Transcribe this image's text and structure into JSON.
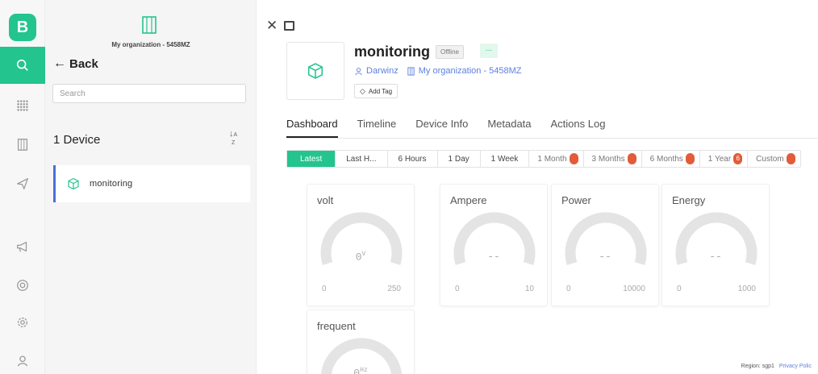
{
  "app": {
    "logo_letter": "B"
  },
  "panel": {
    "org_name": "My organization - 5458MZ",
    "back_label": "Back",
    "search_placeholder": "Search",
    "device_count": "1 Device",
    "devices": [
      {
        "name": "monitoring"
      }
    ]
  },
  "device": {
    "title": "monitoring",
    "status": "Offline",
    "more": "...",
    "owner": "Darwinz",
    "organization": "My organization - 5458MZ",
    "add_tag": "Add Tag"
  },
  "tabs": [
    {
      "label": "Dashboard",
      "active": true
    },
    {
      "label": "Timeline"
    },
    {
      "label": "Device Info"
    },
    {
      "label": "Metadata"
    },
    {
      "label": "Actions Log"
    }
  ],
  "ranges": [
    {
      "label": "Latest",
      "active": true
    },
    {
      "label": "Last H..."
    },
    {
      "label": "6 Hours"
    },
    {
      "label": "1 Day"
    },
    {
      "label": "1 Week"
    },
    {
      "label": "1 Month",
      "badge": ""
    },
    {
      "label": "3 Months",
      "badge": ""
    },
    {
      "label": "6 Months",
      "badge": ""
    },
    {
      "label": "1 Year",
      "badge": "6"
    },
    {
      "label": "Custom",
      "badge": ""
    }
  ],
  "widgets": [
    {
      "title": "volt",
      "value": "0",
      "unit": "V",
      "min": "0",
      "max": "250"
    },
    {
      "title": "Ampere",
      "value": "--",
      "min": "0",
      "max": "10"
    },
    {
      "title": "Power",
      "value": "--",
      "min": "0",
      "max": "10000"
    },
    {
      "title": "Energy",
      "value": "--",
      "min": "0",
      "max": "1000"
    },
    {
      "title": "frequent",
      "value": "0",
      "unit": "Hz"
    }
  ],
  "footer": {
    "region": "Region: sgp1",
    "privacy": "Privacy Polic"
  },
  "colors": {
    "accent": "#23c48e",
    "link": "#5d7fe0",
    "badge": "#e25c3a",
    "selected_border": "#4a6fd6"
  }
}
